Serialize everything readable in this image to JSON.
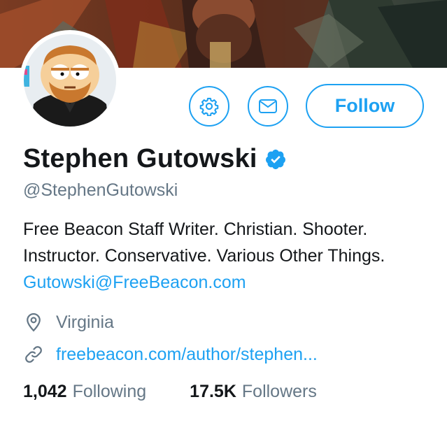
{
  "profile": {
    "name": "Stephen Gutowski",
    "handle": "@StephenGutowski",
    "verified": true,
    "bio_text": "Free Beacon Staff Writer. Christian. Shooter. Instructor. Conservative. Various Other Things. ",
    "bio_email": "Gutowski@FreeBeacon.com",
    "location": "Virginia",
    "website": "freebeacon.com/author/stephen..."
  },
  "actions": {
    "settings_icon": "gear-icon",
    "message_icon": "envelope-icon",
    "follow_label": "Follow"
  },
  "stats": {
    "following_count": "1,042",
    "following_label": "Following",
    "followers_count": "17.5K",
    "followers_label": "Followers"
  },
  "colors": {
    "accent": "#1da1f2",
    "text_primary": "#14171a",
    "text_secondary": "#657786"
  }
}
